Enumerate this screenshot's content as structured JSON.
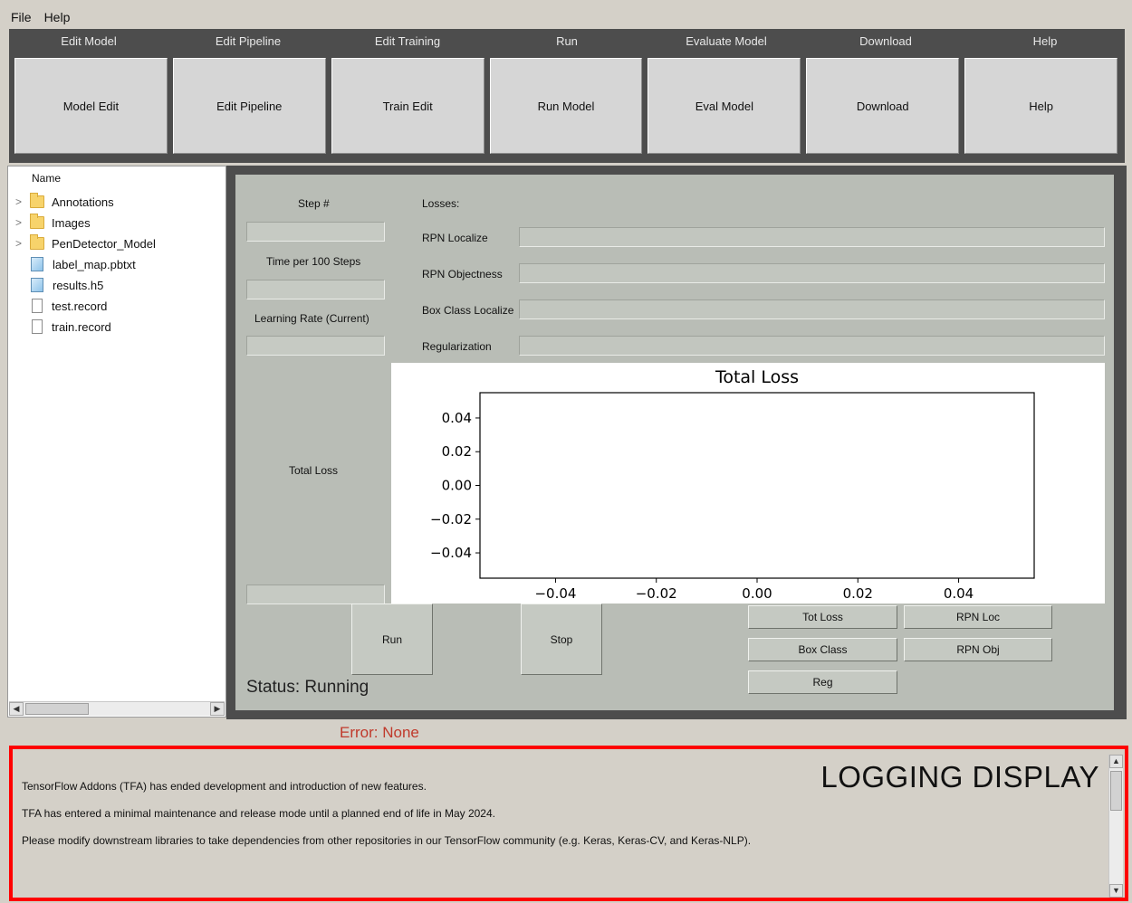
{
  "menu": {
    "file": "File",
    "help": "Help"
  },
  "top_tabs": [
    "Edit Model",
    "Edit Pipeline",
    "Edit Training",
    "Run",
    "Evaluate Model",
    "Download",
    "Help"
  ],
  "top_buttons": [
    "Model Edit",
    "Edit Pipeline",
    "Train Edit",
    "Run Model",
    "Eval Model",
    "Download",
    "Help"
  ],
  "file_tree": {
    "header": "Name",
    "items": [
      {
        "name": "Annotations",
        "icon": "folder-icon",
        "expandable": true
      },
      {
        "name": "Images",
        "icon": "folder-icon",
        "expandable": true
      },
      {
        "name": "PenDetector_Model",
        "icon": "folder-icon",
        "expandable": true
      },
      {
        "name": "label_map.pbtxt",
        "icon": "file-blue-icon",
        "expandable": false
      },
      {
        "name": "results.h5",
        "icon": "file-blue-icon",
        "expandable": false
      },
      {
        "name": "test.record",
        "icon": "file-icon",
        "expandable": false
      },
      {
        "name": "train.record",
        "icon": "file-icon",
        "expandable": false
      }
    ]
  },
  "stats": {
    "step": "Step #",
    "time_per_100": "Time per 100 Steps",
    "learning_rate": "Learning Rate (Current)",
    "total_loss": "Total Loss"
  },
  "losses": {
    "header": "Losses:",
    "rpn_localize": "RPN Localize",
    "rpn_objectness": "RPN Objectness",
    "box_class_localize": "Box Class Localize",
    "regularization": "Regularization"
  },
  "chart_data": {
    "type": "line",
    "title": "Total Loss",
    "xlabel": "",
    "ylabel": "",
    "xlim": [
      -0.055,
      0.055
    ],
    "ylim": [
      -0.055,
      0.055
    ],
    "xticks": [
      "−0.04",
      "−0.02",
      "0.00",
      "0.02",
      "0.04"
    ],
    "xtick_values": [
      -0.04,
      -0.02,
      0.0,
      0.02,
      0.04
    ],
    "yticks": [
      "0.04",
      "0.02",
      "0.00",
      "−0.02",
      "−0.04"
    ],
    "ytick_values": [
      0.04,
      0.02,
      0.0,
      -0.02,
      -0.04
    ],
    "series": [],
    "grid": false
  },
  "controls": {
    "run": "Run",
    "stop": "Stop",
    "tot_loss": "Tot Loss",
    "rpn_loc": "RPN Loc",
    "box_class": "Box Class",
    "rpn_obj": "RPN Obj",
    "reg": "Reg"
  },
  "status": "Status: Running",
  "error": "Error: None",
  "logging": {
    "title": "LOGGING DISPLAY",
    "lines": [
      "TensorFlow Addons (TFA) has ended development and introduction of new features.",
      "TFA has entered a minimal maintenance and release mode until a planned end of life in May 2024.",
      "Please modify downstream libraries to take dependencies from other repositories in our TensorFlow community (e.g. Keras, Keras-CV, and Keras-NLP)."
    ]
  },
  "colors": {
    "log_border": "#ff0000",
    "error_text": "#c0392b",
    "dark_frame": "#4d4d4d",
    "panel": "#b9bdb6"
  }
}
